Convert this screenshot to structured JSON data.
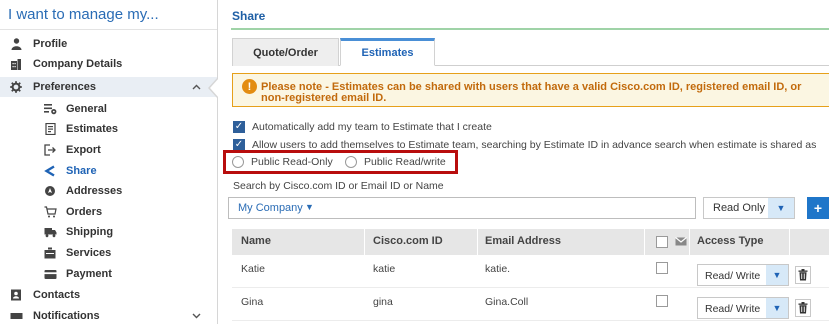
{
  "sidebar": {
    "heading": "I want to manage my...",
    "items": [
      {
        "label": "Profile",
        "icon": "person-icon"
      },
      {
        "label": "Company Details",
        "icon": "building-icon"
      },
      {
        "label": "Preferences",
        "icon": "gear-icon"
      },
      {
        "label": "General",
        "icon": "general-settings-icon"
      },
      {
        "label": "Estimates",
        "icon": "document-icon"
      },
      {
        "label": "Export",
        "icon": "export-icon"
      },
      {
        "label": "Share",
        "icon": "share-icon"
      },
      {
        "label": "Addresses",
        "icon": "location-pin-icon"
      },
      {
        "label": "Orders",
        "icon": "cart-icon"
      },
      {
        "label": "Shipping",
        "icon": "truck-icon"
      },
      {
        "label": "Services",
        "icon": "services-icon"
      },
      {
        "label": "Payment",
        "icon": "credit-card-icon"
      },
      {
        "label": "Contacts",
        "icon": "contacts-icon"
      },
      {
        "label": "Notifications",
        "icon": "notification-icon"
      }
    ],
    "selected_item": "Share"
  },
  "main": {
    "title": "Share",
    "tabs": [
      {
        "label": "Quote/Order",
        "active": false
      },
      {
        "label": "Estimates",
        "active": true
      }
    ],
    "notice": {
      "text": "Please note - Estimates can be shared with users that have a valid Cisco.com ID, registered email ID, or non-registered email ID."
    },
    "options": {
      "auto_add_team": "Automatically add my team to Estimate that I create",
      "allow_users": "Allow users to add themselves to Estimate team, searching by Estimate ID in advance search when estimate is shared as"
    },
    "radios": {
      "public_read_only": "Public Read-Only",
      "public_read_write": "Public Read/write"
    },
    "search": {
      "label": "Search by Cisco.com ID or Email ID or Name",
      "company": "My Company",
      "access_default": "Read Only"
    },
    "table": {
      "columns": [
        "Name",
        "Cisco.com ID",
        "Email Address",
        "Access Type"
      ],
      "rows": [
        {
          "name": "Katie",
          "cisco_id": "katie",
          "email": "katie.",
          "access": "Read/ Write"
        },
        {
          "name": "Gina",
          "cisco_id": "gina",
          "email": "Gina.Coll",
          "access": "Read/ Write"
        }
      ]
    }
  },
  "colors": {
    "brand_blue": "#1f63b5",
    "notice_border": "#e6a01a",
    "notice_text": "#c26a0c",
    "highlight_red": "#b80d0d",
    "tab_active_accent": "#4a8fd6"
  }
}
